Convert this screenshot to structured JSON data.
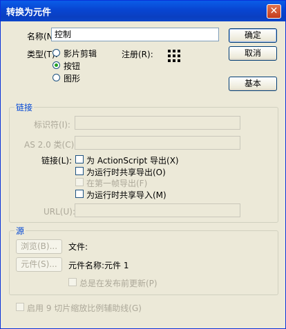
{
  "window": {
    "title": "转换为元件",
    "close_glyph": "✕"
  },
  "name_field": {
    "label": "名称(N):",
    "value": "控制"
  },
  "type_group": {
    "label": "类型(T):",
    "options": [
      {
        "label": "影片剪辑",
        "selected": false
      },
      {
        "label": "按钮",
        "selected": true
      },
      {
        "label": "图形",
        "selected": false
      }
    ]
  },
  "registration": {
    "label": "注册(R):",
    "icon": "registration-grid-icon"
  },
  "buttons": {
    "ok": "确定",
    "cancel": "取消",
    "basic": "基本"
  },
  "linkage": {
    "title": "链接",
    "identifier_label": "标识符(I):",
    "identifier_value": "",
    "as2_class_label": "AS 2.0 类(C):",
    "as2_class_value": "",
    "linkage_label": "链接(L):",
    "options": [
      {
        "label": "为 ActionScript 导出(X)",
        "checked": false,
        "enabled": true
      },
      {
        "label": "为运行时共享导出(O)",
        "checked": false,
        "enabled": true
      },
      {
        "label": "在第一帧导出(F)",
        "checked": false,
        "enabled": false
      },
      {
        "label": "为运行时共享导入(M)",
        "checked": false,
        "enabled": true
      }
    ],
    "url_label": "URL(U):",
    "url_value": ""
  },
  "source": {
    "title": "源",
    "browse_button": "浏览(B)...",
    "file_label": "文件:",
    "symbol_button": "元件(S)...",
    "symbol_name_text": "元件名称:元件 1",
    "always_update_label": "总是在发布前更新(P)"
  },
  "scale9": {
    "label": "启用 9 切片缩放比例辅助线(G)"
  },
  "colors": {
    "title_bar": "#0a4fd6",
    "dialog_bg": "#ece9d8",
    "group_title": "#0046d5",
    "disabled_text": "#aca899"
  }
}
